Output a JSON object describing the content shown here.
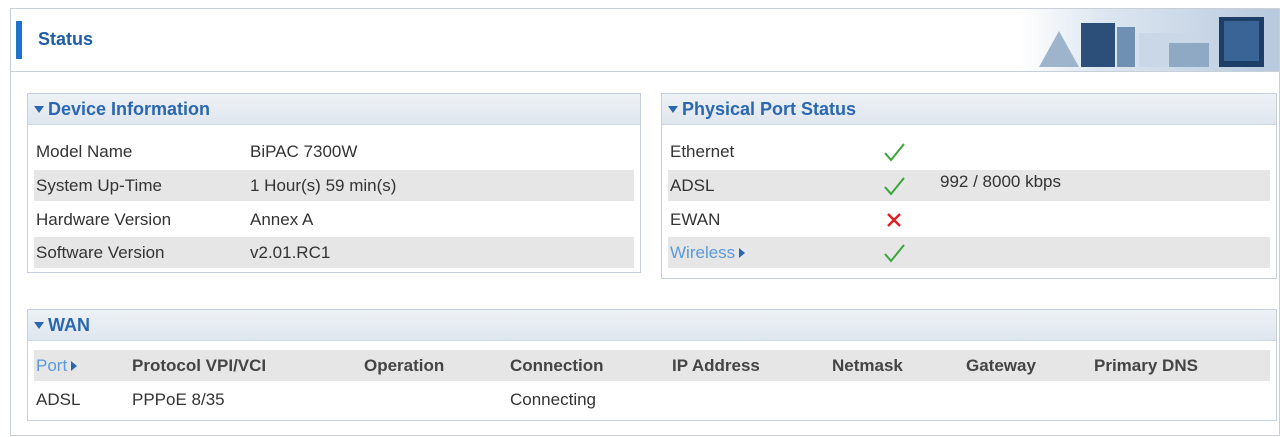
{
  "page": {
    "title": "Status"
  },
  "device_info": {
    "title": "Device Information",
    "rows": [
      {
        "label": "Model Name",
        "value": "BiPAC 7300W"
      },
      {
        "label": "System Up-Time",
        "value": "1 Hour(s) 59 min(s)"
      },
      {
        "label": "Hardware Version",
        "value": "Annex A"
      },
      {
        "label": "Software Version",
        "value": "v2.01.RC1"
      }
    ]
  },
  "port_status": {
    "title": "Physical Port Status",
    "rows": [
      {
        "label": "Ethernet",
        "status": "ok",
        "extra": ""
      },
      {
        "label": "ADSL",
        "status": "ok",
        "extra": "992 / 8000 kbps"
      },
      {
        "label": "EWAN",
        "status": "fail",
        "extra": ""
      },
      {
        "label": "Wireless",
        "status": "ok",
        "extra": ""
      }
    ]
  },
  "wan": {
    "title": "WAN",
    "headers": [
      "Port",
      "Protocol VPI/VCI",
      "Operation",
      "Connection",
      "IP Address",
      "Netmask",
      "Gateway",
      "Primary DNS"
    ],
    "row": [
      "ADSL",
      "PPPoE 8/35",
      "",
      "Connecting",
      "",
      "",
      "",
      ""
    ]
  },
  "colors": {
    "accent": "#1f74c9",
    "ok": "#3aa53a",
    "fail": "#e02020",
    "link": "#5a9ad8"
  }
}
